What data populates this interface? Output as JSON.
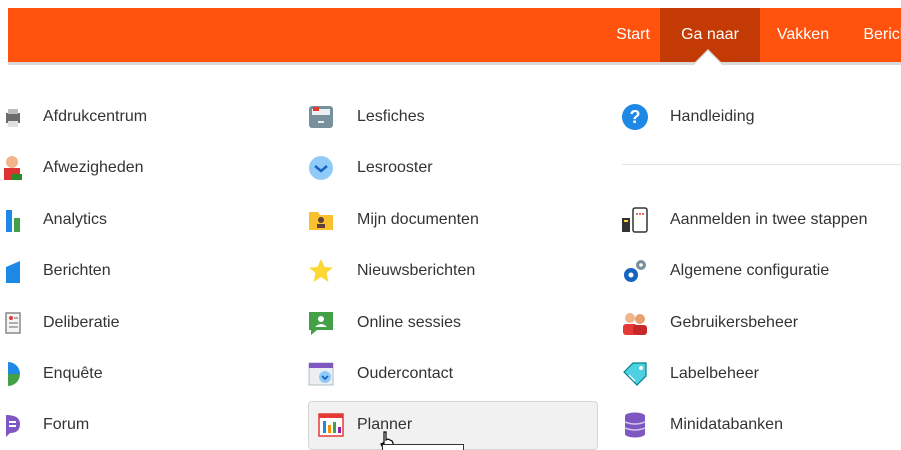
{
  "nav": {
    "start": "Start",
    "ga_naar": "Ga naar",
    "vakken": "Vakken",
    "berichten": "Berich"
  },
  "col1": [
    {
      "label": "Afdrukcentrum",
      "icon": "printer-icon"
    },
    {
      "label": "Afwezigheden",
      "icon": "person-absent-icon"
    },
    {
      "label": "Analytics",
      "icon": "bar-chart-icon"
    },
    {
      "label": "Berichten",
      "icon": "message-icon"
    },
    {
      "label": "Deliberatie",
      "icon": "clipboard-icon"
    },
    {
      "label": "Enquête",
      "icon": "pie-chart-icon"
    },
    {
      "label": "Forum",
      "icon": "chat-bubble-icon"
    }
  ],
  "col2": [
    {
      "label": "Lesfiches",
      "icon": "file-cabinet-icon"
    },
    {
      "label": "Lesrooster",
      "icon": "clock-icon"
    },
    {
      "label": "Mijn documenten",
      "icon": "folder-user-icon"
    },
    {
      "label": "Nieuwsberichten",
      "icon": "star-icon"
    },
    {
      "label": "Online sessies",
      "icon": "video-chat-icon"
    },
    {
      "label": "Oudercontact",
      "icon": "calendar-clock-icon"
    },
    {
      "label": "Planner",
      "icon": "planner-chart-icon"
    }
  ],
  "col3": [
    {
      "label": "Handleiding",
      "icon": "help-icon"
    },
    {
      "label": "Aanmelden in twee stappen",
      "icon": "two-factor-icon"
    },
    {
      "label": "Algemene configuratie",
      "icon": "gears-icon"
    },
    {
      "label": "Gebruikersbeheer",
      "icon": "users-icon"
    },
    {
      "label": "Labelbeheer",
      "icon": "tag-icon"
    },
    {
      "label": "Minidatabanken",
      "icon": "database-icon"
    }
  ],
  "colors": {
    "topbar": "#ff520d",
    "active_tab": "#c43a04"
  }
}
